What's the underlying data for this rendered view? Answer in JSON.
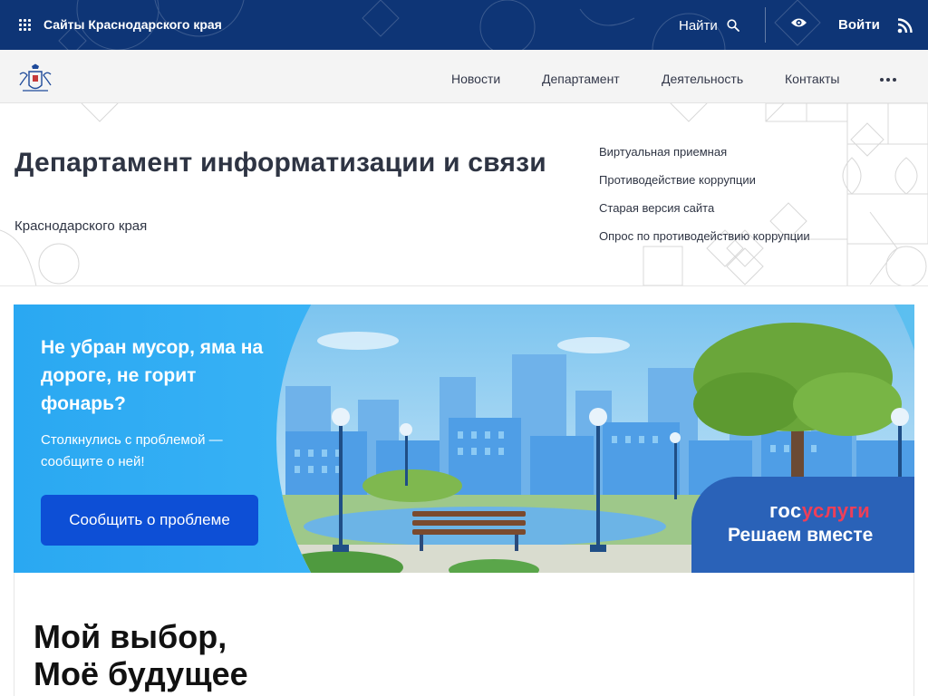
{
  "topbar": {
    "sites_label": "Сайты Краснодарского края",
    "find_label": "Найти",
    "login_label": "Войти"
  },
  "nav": {
    "items": [
      "Новости",
      "Департамент",
      "Деятельность",
      "Контакты"
    ]
  },
  "header": {
    "title": "Департамент информатизации и связи",
    "subtitle": "Краснодарского края",
    "quick_links": [
      "Виртуальная приемная",
      "Противодействие коррупции",
      "Старая версия сайта",
      "Опрос по противодействию коррупции"
    ]
  },
  "banner": {
    "heading": "Не убран мусор, яма на дороге, не горит фонарь?",
    "text": "Столкнулись с проблемой — сообщите о ней!",
    "button_label": "Сообщить о проблеме",
    "logo_part1": "гос",
    "logo_part2": "услуги",
    "tagline": "Решаем вместе"
  },
  "card": {
    "title_line1": "Мой выбор,",
    "title_line2": "Моё будущее"
  },
  "colors": {
    "topbar_bg": "#0e3576",
    "banner_button": "#0d4fd6",
    "gosuslugi_blue": "#2a62b8",
    "gosuslugi_red": "#ee3f58"
  }
}
